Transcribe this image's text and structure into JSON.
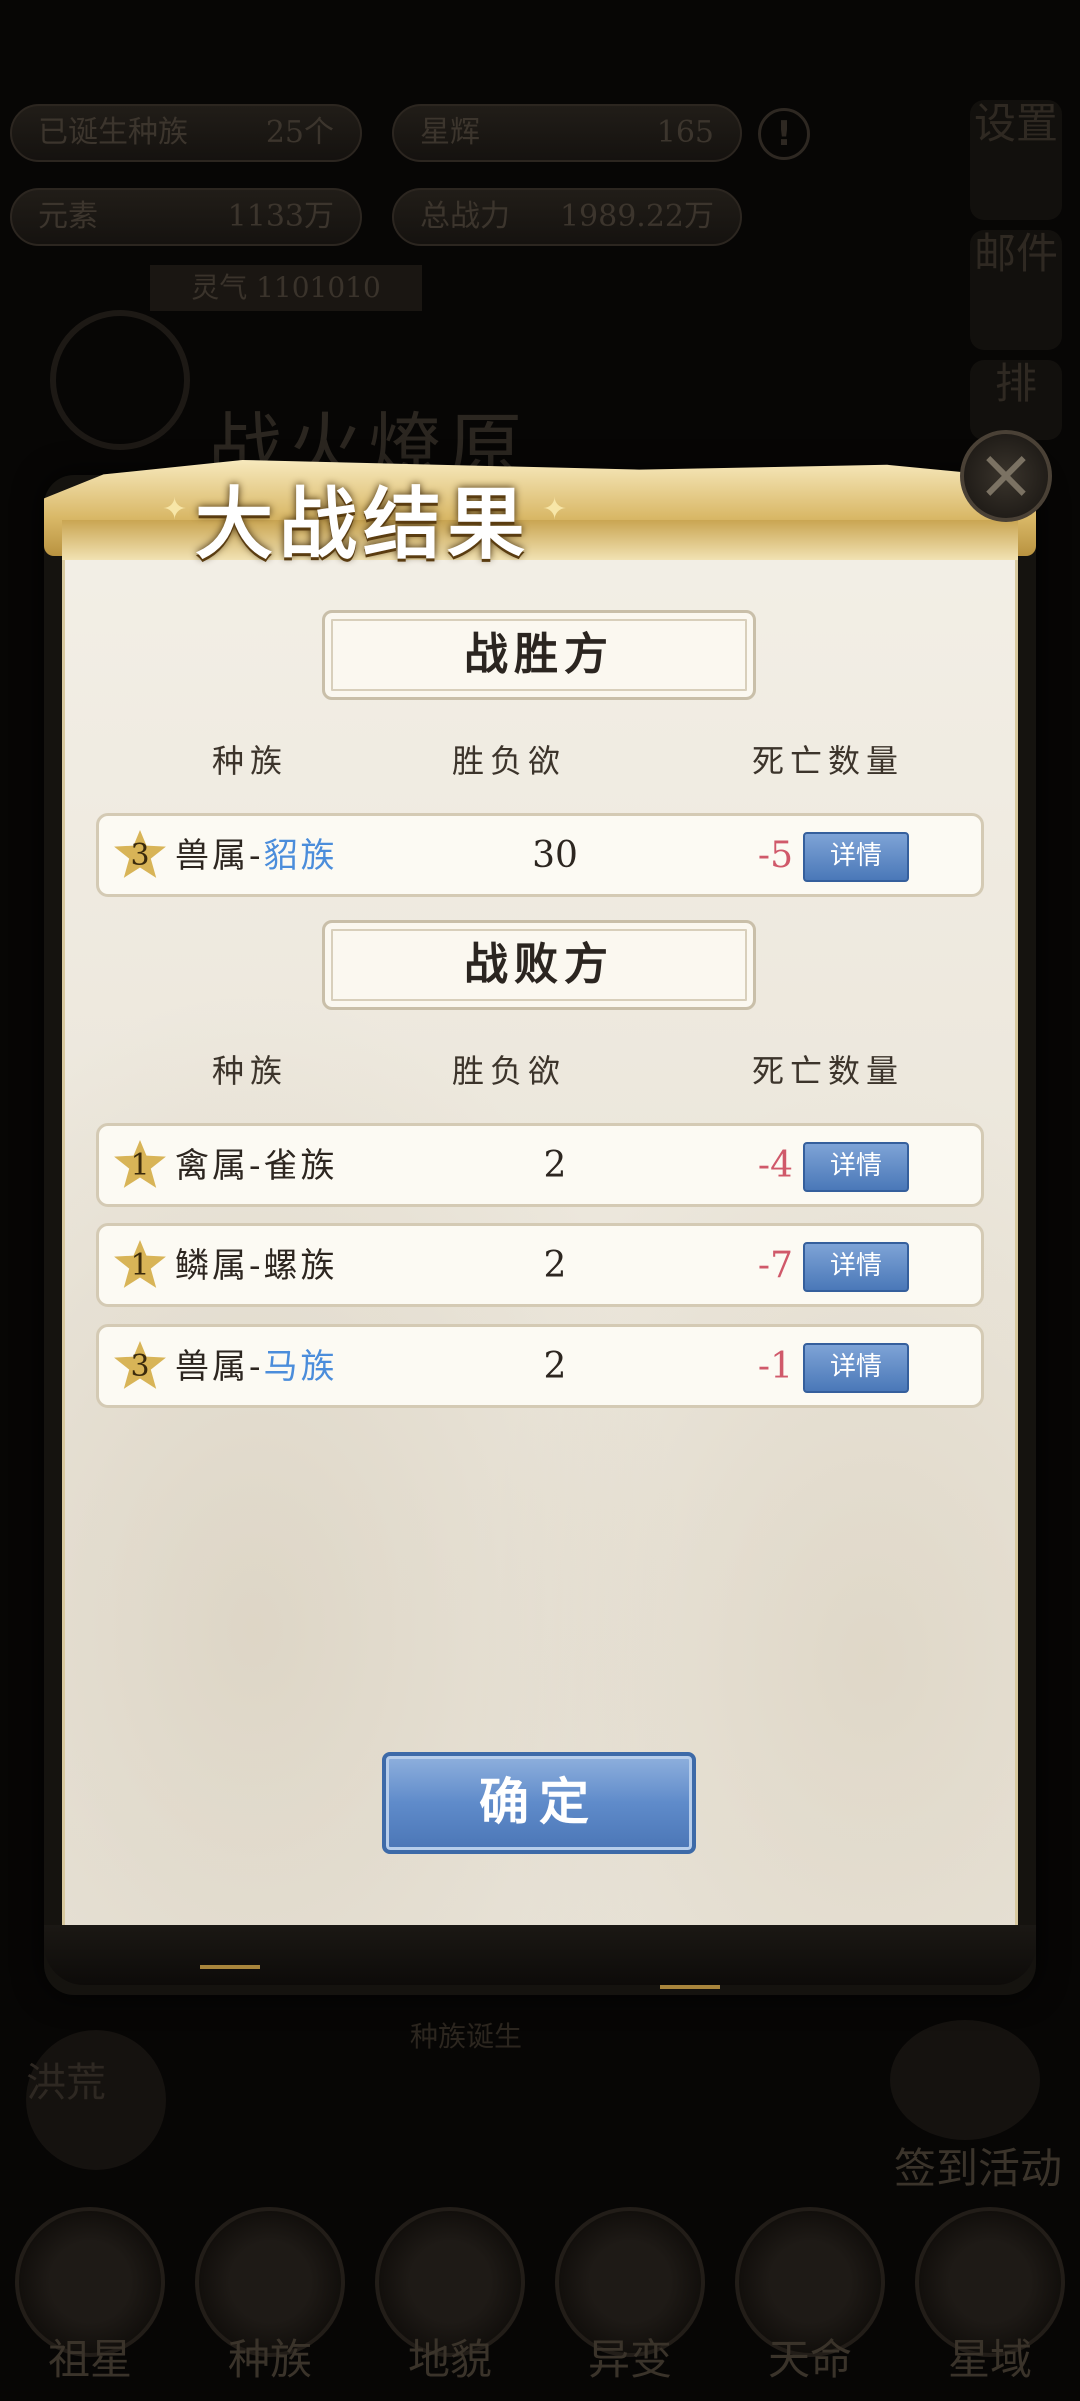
{
  "background": {
    "stats": [
      {
        "label": "已诞生种族",
        "value": "25个"
      },
      {
        "label": "星辉",
        "value": "165"
      },
      {
        "label": "元素",
        "value": "1133万"
      },
      {
        "label": "总战力",
        "value": "1989.22万"
      }
    ],
    "badge": "灵气 1101010",
    "side_buttons": [
      "设置",
      "邮件",
      "排"
    ],
    "bg_title": "战火燎原",
    "footer_text": "种族诞生",
    "left_label": "洪荒",
    "right_label": "签到活动",
    "nav": [
      "祖星",
      "种族",
      "地貌",
      "异变",
      "天命",
      "星域"
    ]
  },
  "modal": {
    "title": "大战结果",
    "close_icon": "close-icon",
    "winners": {
      "header": "战胜方",
      "columns": [
        "种族",
        "胜负欲",
        "死亡数量"
      ],
      "rows": [
        {
          "rank": "3",
          "category": "兽属-",
          "name": "貂族",
          "name_color": "blue",
          "value": "30",
          "deaths": "-5",
          "detail": "详情"
        }
      ]
    },
    "losers": {
      "header": "战败方",
      "columns": [
        "种族",
        "胜负欲",
        "死亡数量"
      ],
      "rows": [
        {
          "rank": "1",
          "category": "禽属-",
          "name": "雀族",
          "name_color": "dark",
          "value": "2",
          "deaths": "-4",
          "detail": "详情"
        },
        {
          "rank": "1",
          "category": "鳞属-",
          "name": "螺族",
          "name_color": "dark",
          "value": "2",
          "deaths": "-7",
          "detail": "详情"
        },
        {
          "rank": "3",
          "category": "兽属-",
          "name": "马族",
          "name_color": "blue",
          "value": "2",
          "deaths": "-1",
          "detail": "详情"
        }
      ]
    },
    "confirm": "确定"
  },
  "colors": {
    "accent_blue": "#4b8ddb",
    "death_red": "#d0596a",
    "gold": "#d8b457"
  }
}
